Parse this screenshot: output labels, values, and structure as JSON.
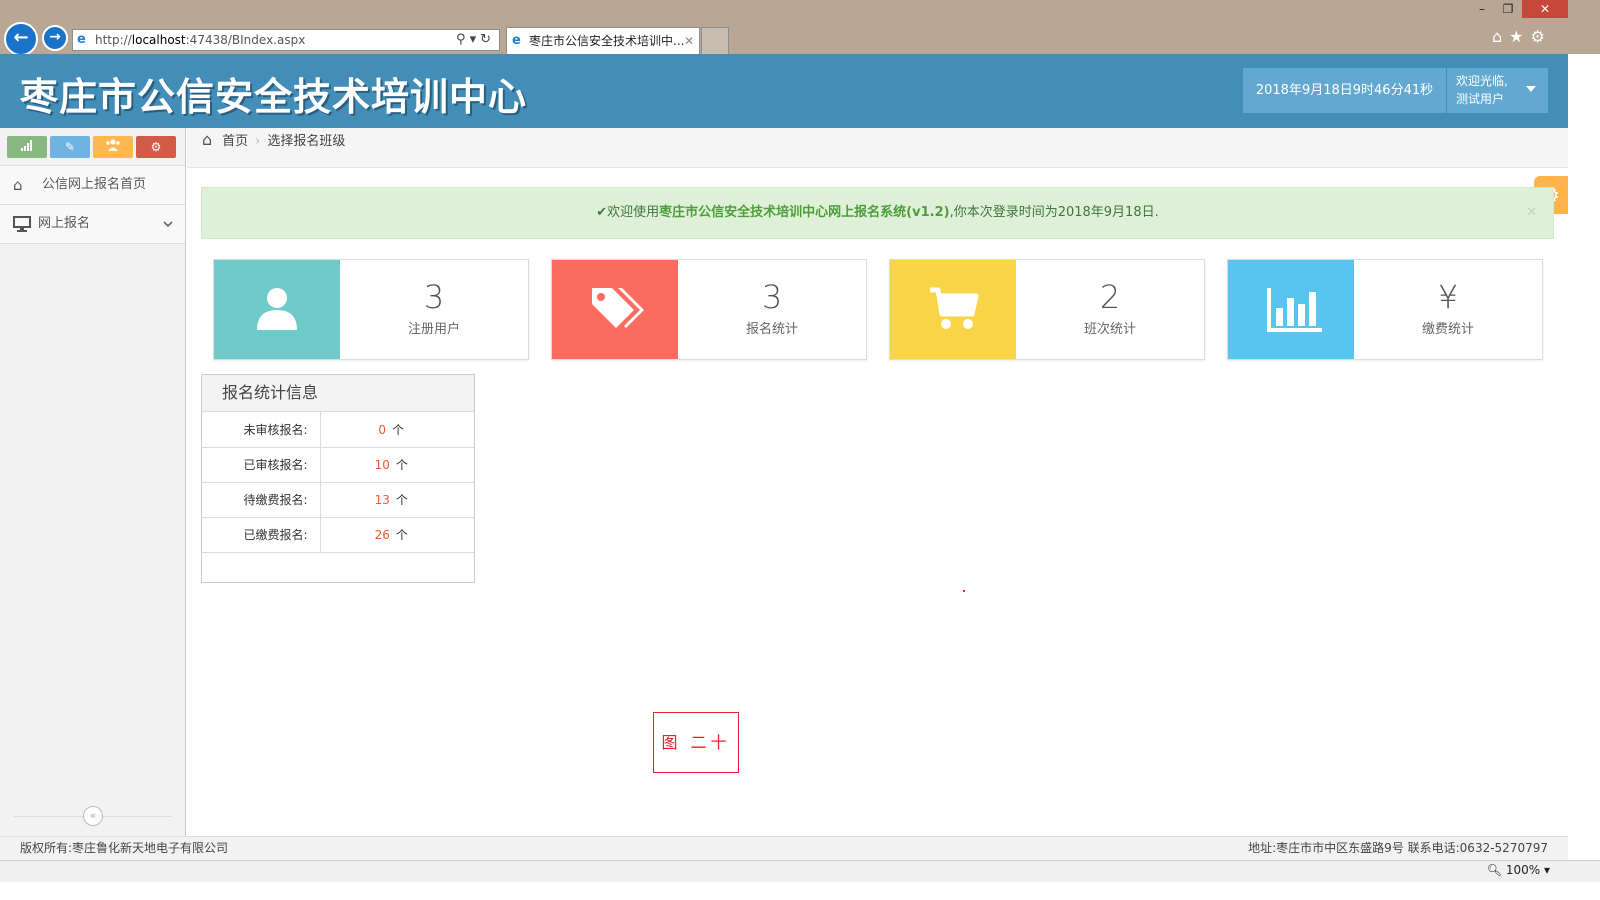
{
  "browser": {
    "url_scheme": "http://",
    "url_host": "localhost",
    "url_rest": ":47438/BIndex.aspx",
    "tab_title": "枣庄市公信安全技术培训中...",
    "zoom": "100%"
  },
  "header": {
    "logo": "枣庄市公信安全技术培训中心",
    "datetime": "2018年9月18日9时46分41秒",
    "welcome_line1": "欢迎光临,",
    "welcome_line2": "测试用户"
  },
  "sidebar": {
    "items": [
      {
        "label": "公信网上报名首页",
        "icon": "home-icon"
      },
      {
        "label": "网上报名",
        "icon": "desktop-icon"
      }
    ]
  },
  "breadcrumb": {
    "home": "首页",
    "current": "选择报名班级"
  },
  "alert": {
    "prefix": "欢迎使用",
    "highlight": "枣庄市公信安全技术培训中心网上报名系统(v1.2)",
    "suffix": ",你本次登录时间为2018年9月18日."
  },
  "stats": [
    {
      "value": "3",
      "label": "注册用户",
      "color": "#6fcbc9",
      "icon": "user-icon"
    },
    {
      "value": "3",
      "label": "报名统计",
      "color": "#fb6c60",
      "icon": "tags-icon"
    },
    {
      "value": "2",
      "label": "班次统计",
      "color": "#f7d547",
      "icon": "cart-icon"
    },
    {
      "value": "¥",
      "label": "缴费统计",
      "color": "#57c5f0",
      "icon": "bar-chart-icon"
    }
  ],
  "panel": {
    "title": "报名统计信息",
    "unit": "个",
    "rows": [
      {
        "key": "未审核报名:",
        "value": "0"
      },
      {
        "key": "已审核报名:",
        "value": "10"
      },
      {
        "key": "待缴费报名:",
        "value": "13"
      },
      {
        "key": "已缴费报名:",
        "value": "26"
      }
    ]
  },
  "figure_label": "图 二十",
  "footer": {
    "copyright": "版权所有:枣庄鲁化新天地电子有限公司",
    "contact": "地址:枣庄市市中区东盛路9号 联系电话:0632-5270797"
  }
}
